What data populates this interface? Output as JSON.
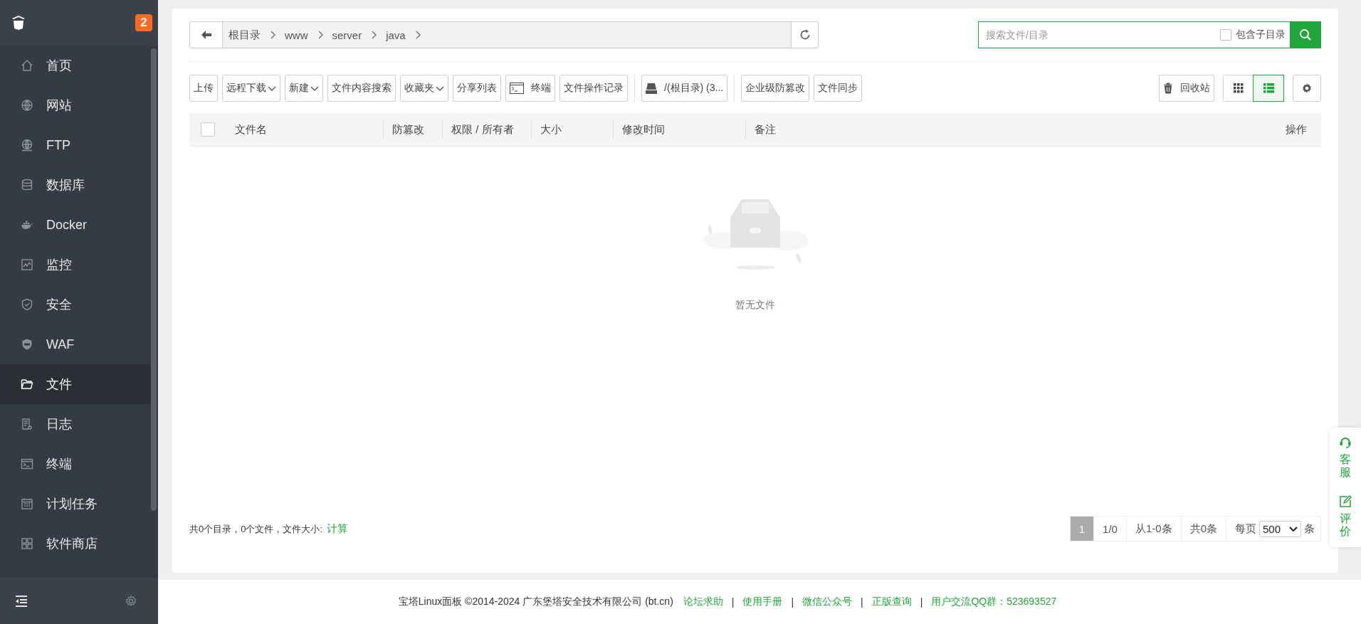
{
  "sidebar": {
    "badge": "2",
    "items": [
      {
        "label": "首页",
        "selected": false
      },
      {
        "label": "网站",
        "selected": false
      },
      {
        "label": "FTP",
        "selected": false
      },
      {
        "label": "数据库",
        "selected": false
      },
      {
        "label": "Docker",
        "selected": false
      },
      {
        "label": "监控",
        "selected": false
      },
      {
        "label": "安全",
        "selected": false
      },
      {
        "label": "WAF",
        "selected": false
      },
      {
        "label": "文件",
        "selected": true
      },
      {
        "label": "日志",
        "selected": false
      },
      {
        "label": "终端",
        "selected": false
      },
      {
        "label": "计划任务",
        "selected": false
      },
      {
        "label": "软件商店",
        "selected": false
      }
    ]
  },
  "breadcrumb": {
    "segments": [
      "根目录",
      "www",
      "server",
      "java"
    ]
  },
  "search": {
    "placeholder": "搜索文件/目录",
    "include_subdirs": {
      "label": "包含子目录",
      "checked": false
    }
  },
  "toolbar": {
    "buttons": [
      {
        "label": "上传",
        "kind": "plain"
      },
      {
        "label": "远程下载",
        "kind": "dropdown"
      },
      {
        "label": "新建",
        "kind": "dropdown"
      },
      {
        "label": "文件内容搜索",
        "kind": "plain"
      },
      {
        "label": "收藏夹",
        "kind": "dropdown"
      },
      {
        "label": "分享列表",
        "kind": "plain"
      },
      {
        "label": "终端",
        "kind": "terminal"
      },
      {
        "label": "文件操作记录",
        "kind": "plain"
      },
      {
        "label": "/(根目录) (3...",
        "kind": "disk"
      },
      {
        "label": "企业级防篡改",
        "kind": "plain"
      },
      {
        "label": "文件同步",
        "kind": "plain"
      }
    ],
    "recycle": "回收站",
    "views": [
      {
        "kind": "grid",
        "selected": false
      },
      {
        "kind": "list",
        "selected": true
      }
    ]
  },
  "table": {
    "select_all_checked": false,
    "columns": [
      "文件名",
      "防篡改",
      "权限 / 所有者",
      "大小",
      "修改时间",
      "备注",
      "操作"
    ],
    "empty_text": "暂无文件"
  },
  "summary": {
    "text": "共0个目录，0个文件，文件大小:",
    "link": "计算"
  },
  "pagination": {
    "pages": [
      {
        "label": "1",
        "selected": true
      }
    ],
    "page_info": "1/0",
    "range": "从1-0条",
    "total": "共0条",
    "per_page_label": "每页",
    "per_page": "500",
    "unit": "条"
  },
  "footer": {
    "copyright": "宝塔Linux面板 ©2014-2024 广东堡塔安全技术有限公司 (bt.cn)",
    "separator": "|",
    "links": [
      "论坛求助",
      "使用手册",
      "微信公众号",
      "正版查询",
      "用户交流QQ群：523693527"
    ]
  },
  "float_panel": [
    "客服",
    "评价"
  ]
}
